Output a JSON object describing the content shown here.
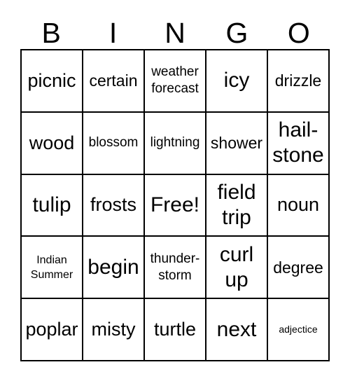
{
  "card": {
    "header_letters": [
      "B",
      "I",
      "N",
      "G",
      "O"
    ],
    "rows": [
      [
        {
          "text": "picnic",
          "size": "lg"
        },
        {
          "text": "certain",
          "size": "md"
        },
        {
          "text": "weather\nforecast",
          "size": "sm"
        },
        {
          "text": "icy",
          "size": "xl"
        },
        {
          "text": "drizzle",
          "size": "md"
        }
      ],
      [
        {
          "text": "wood",
          "size": "lg"
        },
        {
          "text": "blossom",
          "size": "sm"
        },
        {
          "text": "lightning",
          "size": "sm"
        },
        {
          "text": "shower",
          "size": "md"
        },
        {
          "text": "hail-\nstone",
          "size": "xl"
        }
      ],
      [
        {
          "text": "tulip",
          "size": "xl"
        },
        {
          "text": "frosts",
          "size": "lg"
        },
        {
          "text": "Free!",
          "size": "xl"
        },
        {
          "text": "field\ntrip",
          "size": "xl"
        },
        {
          "text": "noun",
          "size": "lg"
        }
      ],
      [
        {
          "text": "Indian\nSummer",
          "size": "xs"
        },
        {
          "text": "begin",
          "size": "xl"
        },
        {
          "text": "thunder-\nstorm",
          "size": "sm"
        },
        {
          "text": "curl\nup",
          "size": "xl"
        },
        {
          "text": "degree",
          "size": "md"
        }
      ],
      [
        {
          "text": "poplar",
          "size": "lg"
        },
        {
          "text": "misty",
          "size": "lg"
        },
        {
          "text": "turtle",
          "size": "lg"
        },
        {
          "text": "next",
          "size": "xl"
        },
        {
          "text": "adjectice",
          "size": "xxs"
        }
      ]
    ],
    "free_space_label": "Free!",
    "colors": {
      "background": "#ffffff",
      "text": "#000000",
      "grid_line": "#000000"
    }
  }
}
